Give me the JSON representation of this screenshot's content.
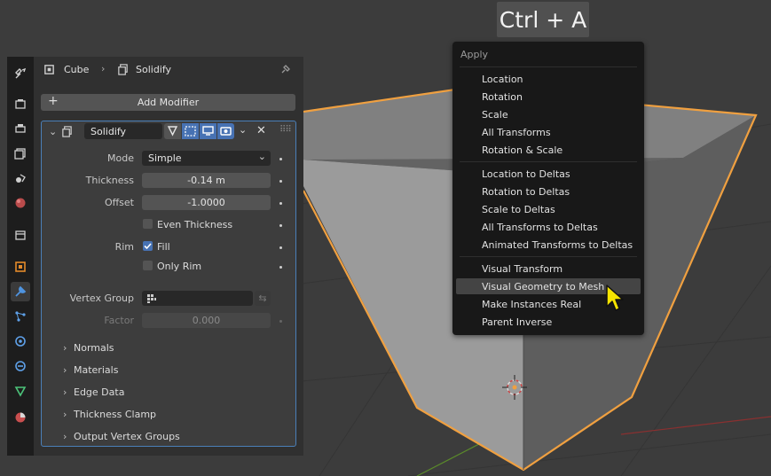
{
  "overlay": {
    "key_combo": "Ctrl + A"
  },
  "header": {
    "object": "Cube",
    "modifier": "Solidify"
  },
  "toolbar": {
    "add_modifier": "Add Modifier"
  },
  "modifier": {
    "name": "Solidify",
    "rows": {
      "mode": {
        "label": "Mode",
        "value": "Simple"
      },
      "thickness": {
        "label": "Thickness",
        "value": "-0.14 m"
      },
      "offset": {
        "label": "Offset",
        "value": "-1.0000"
      },
      "even_thickness": {
        "label": "Even Thickness",
        "checked": false
      },
      "rim": {
        "label": "Rim"
      },
      "fill": {
        "label": "Fill",
        "checked": true
      },
      "only_rim": {
        "label": "Only Rim",
        "checked": false
      },
      "vertex_group": {
        "label": "Vertex Group",
        "value": ""
      },
      "factor": {
        "label": "Factor",
        "value": "0.000"
      }
    },
    "subpanels": [
      "Normals",
      "Materials",
      "Edge Data",
      "Thickness Clamp",
      "Output Vertex Groups"
    ]
  },
  "menu": {
    "title": "Apply",
    "groups": [
      [
        "Location",
        "Rotation",
        "Scale",
        "All Transforms",
        "Rotation & Scale"
      ],
      [
        "Location to Deltas",
        "Rotation to Deltas",
        "Scale to Deltas",
        "All Transforms to Deltas",
        "Animated Transforms to Deltas"
      ],
      [
        "Visual Transform",
        "Visual Geometry to Mesh",
        "Make Instances Real",
        "Parent Inverse"
      ]
    ],
    "highlighted": "Visual Geometry to Mesh"
  },
  "colors": {
    "selection_outline": "#f0a040",
    "accent_blue": "#4772b3",
    "cursor_yellow": "#f5e400",
    "grid_green": "#5a8a2a",
    "grid_red": "#8a3030"
  },
  "icons": {
    "tabs": [
      "tool-icon",
      "render-icon",
      "output-icon",
      "view-layer-icon",
      "scene-icon",
      "world-icon",
      "collection-icon",
      "object-icon",
      "modifier-icon",
      "particles-icon",
      "physics-icon",
      "constraints-icon",
      "object-data-icon",
      "material-icon"
    ]
  }
}
